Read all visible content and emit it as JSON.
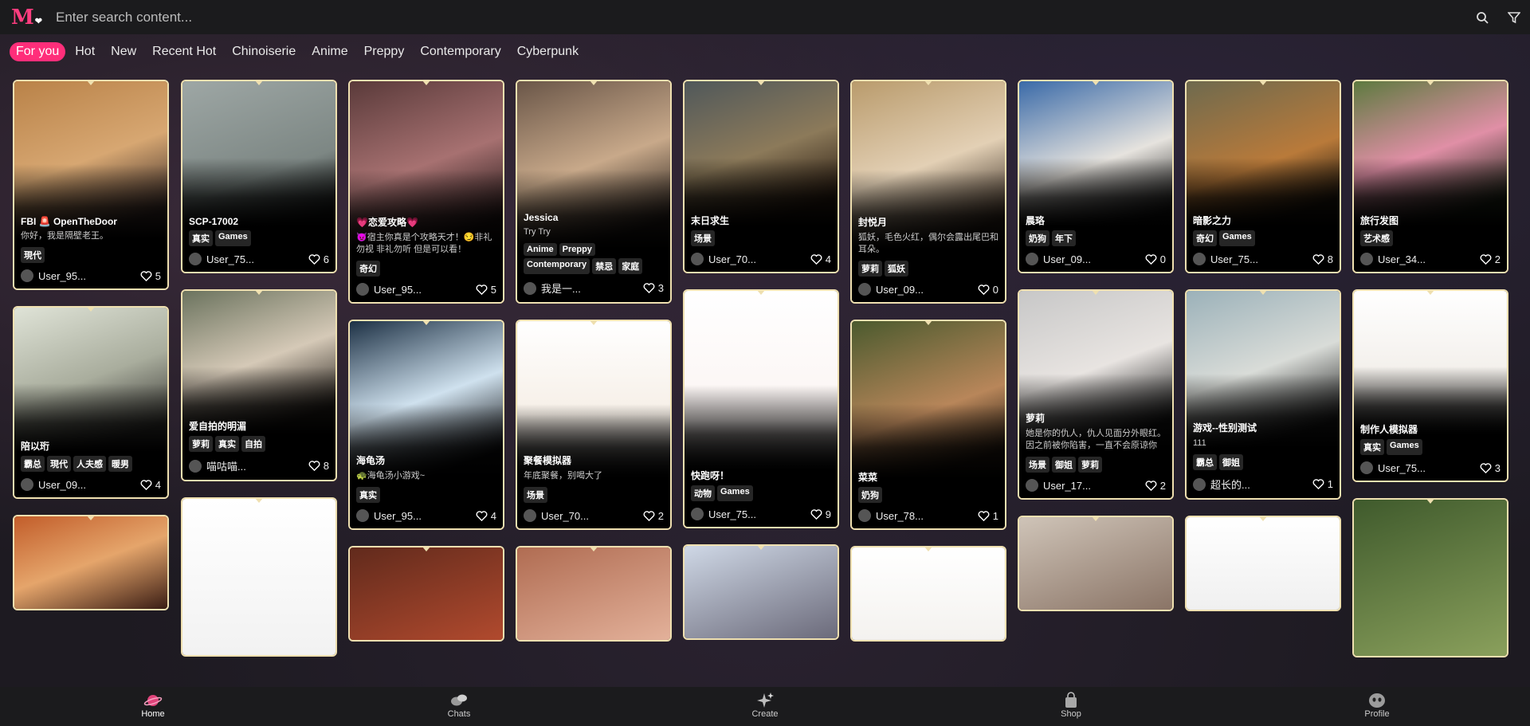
{
  "search": {
    "placeholder": "Enter search content..."
  },
  "tabs": [
    "For you",
    "Hot",
    "New",
    "Recent Hot",
    "Chinoiserie",
    "Anime",
    "Preppy",
    "Contemporary",
    "Cyberpunk"
  ],
  "active_tab": "For you",
  "columns": [
    [
      {
        "title": "FBI 🚨 OpenTheDoor",
        "desc": "你好，我是隔壁老王。",
        "tags": [
          "現代"
        ],
        "user": "User_95...",
        "likes": "5",
        "bg": "linear-gradient(160deg,#b98248,#d7a772 40%,#3a2b28 70%)"
      },
      {
        "title": "陪以珩",
        "desc": "",
        "tags": [
          "霸总",
          "現代",
          "人夫感",
          "暖男"
        ],
        "user": "User_09...",
        "likes": "4",
        "bg": "linear-gradient(160deg,#dfe3d7,#a9ad9d 40%,#3b3a36 70%)"
      },
      {
        "title": "",
        "desc": "",
        "tags": [],
        "user": "",
        "likes": "",
        "bg": "linear-gradient(160deg,#c25d2a,#e5a56b 50%,#3a1d14)"
      }
    ],
    [
      {
        "title": "SCP-17002",
        "desc": "",
        "tags": [
          "真实",
          "Games"
        ],
        "user": "User_75...",
        "likes": "6",
        "bg": "linear-gradient(160deg,#9ea7a5,#7d8784 50%,#1f2221 75%)"
      },
      {
        "title": "爱自拍的明湄",
        "desc": "",
        "tags": [
          "萝莉",
          "真实",
          "自拍"
        ],
        "user": "喵咕喵...",
        "likes": "8",
        "bg": "linear-gradient(160deg,#6b735e,#d5c9b7 40%,#2a241f 70%)"
      },
      {
        "title": "",
        "desc": "",
        "tags": [],
        "user": "",
        "likes": "",
        "bg": "linear-gradient(180deg,#ffffff,#f2f2f2)"
      }
    ],
    [
      {
        "title": "💗恋爱攻略💗",
        "desc": "😈宿主你真是个攻略天才！😏非礼勿视 非礼勿听 但是可以看！",
        "tags": [
          "奇幻"
        ],
        "user": "User_95...",
        "likes": "5",
        "bg": "linear-gradient(160deg,#5a3a3a,#a77171 40%,#1c1212 70%)"
      },
      {
        "title": "海龟汤",
        "desc": "🐢海龟汤小游戏~",
        "tags": [
          "真实"
        ],
        "user": "User_95...",
        "likes": "4",
        "bg": "linear-gradient(160deg,#1d3145,#cfe1ee 40%,#0c0c0e 70%)"
      },
      {
        "title": "",
        "desc": "",
        "tags": [],
        "user": "",
        "likes": "",
        "bg": "linear-gradient(160deg,#612a1c,#b14a2e)"
      }
    ],
    [
      {
        "title": "Jessica",
        "desc": "Try Try",
        "tags": [
          "Anime",
          "Preppy",
          "Contemporary",
          "禁忌",
          "家庭"
        ],
        "user": "我是一...",
        "likes": "3",
        "bg": "linear-gradient(160deg,#6a5648,#c8a98a 40%,#221b17 70%)"
      },
      {
        "title": "聚餐模拟器",
        "desc": "年底聚餐，别喝大了",
        "tags": [
          "场景"
        ],
        "user": "User_70...",
        "likes": "2",
        "bg": "linear-gradient(180deg,#ffffff 0%,#f6efe7 45%,#222 75%)"
      },
      {
        "title": "",
        "desc": "",
        "tags": [],
        "user": "",
        "likes": "",
        "bg": "linear-gradient(160deg,#b06c52,#e3b19a)"
      }
    ],
    [
      {
        "title": "末日求生",
        "desc": "",
        "tags": [
          "场景"
        ],
        "user": "User_70...",
        "likes": "4",
        "bg": "linear-gradient(160deg,#50585a,#8c7a5a 40%,#2a1b10 70%)"
      },
      {
        "title": "快跑呀！",
        "desc": "",
        "tags": [
          "动物",
          "Games"
        ],
        "user": "User_75...",
        "likes": "9",
        "bg": "linear-gradient(180deg,#ffffff 0%,#fbf4f2 55%,#222 80%)"
      },
      {
        "title": "",
        "desc": "",
        "tags": [],
        "user": "",
        "likes": "",
        "bg": "linear-gradient(160deg,#cfd8e6,#6b6a7a)"
      }
    ],
    [
      {
        "title": "封悦月",
        "desc": "狐妖，毛色火红，偶尔会露出尾巴和耳朵。",
        "tags": [
          "萝莉",
          "狐妖"
        ],
        "user": "User_09...",
        "likes": "0",
        "bg": "linear-gradient(160deg,#b99b6c,#e3d0b5 40%,#2d2118 70%)"
      },
      {
        "title": "菜菜",
        "desc": "",
        "tags": [
          "奶狗"
        ],
        "user": "User_78...",
        "likes": "1",
        "bg": "linear-gradient(160deg,#4b5a2e,#b8865a 45%,#251a10 70%)"
      },
      {
        "title": "",
        "desc": "",
        "tags": [],
        "user": "",
        "likes": "",
        "bg": "linear-gradient(180deg,#ffffff,#f4f2ef)"
      }
    ],
    [
      {
        "title": "晨珞",
        "desc": "",
        "tags": [
          "奶狗",
          "年下"
        ],
        "user": "User_09...",
        "likes": "0",
        "bg": "linear-gradient(160deg,#3a6aa8,#e6e3de 45%,#1c1c1c 75%)"
      },
      {
        "title": "萝莉",
        "desc": "她是你的仇人，仇人见面分外眼红。因之前被你陷害，一直不会原谅你",
        "tags": [
          "场景",
          "御姐",
          "萝莉"
        ],
        "user": "User_17...",
        "likes": "2",
        "bg": "linear-gradient(160deg,#c7c7c7,#e8e4e1 40%,#161616 70%)"
      },
      {
        "title": "",
        "desc": "",
        "tags": [],
        "user": "",
        "likes": "",
        "bg": "linear-gradient(160deg,#cfc4b8,#8a7466)"
      }
    ],
    [
      {
        "title": "暗影之力",
        "desc": "",
        "tags": [
          "奇幻",
          "Games"
        ],
        "user": "User_75...",
        "likes": "8",
        "bg": "linear-gradient(160deg,#6e6a4e,#b97a3a 45%,#20180e 70%)"
      },
      {
        "title": "游戏--性别测试",
        "desc": "111",
        "tags": [
          "霸总",
          "御姐"
        ],
        "user": "超长的...",
        "likes": "1",
        "bg": "linear-gradient(160deg,#9bb1b9,#d9dcd8 40%,#1a1a1a 70%)"
      },
      {
        "title": "",
        "desc": "",
        "tags": [],
        "user": "",
        "likes": "",
        "bg": "linear-gradient(180deg,#ffffff,#f0f0f0)"
      }
    ],
    [
      {
        "title": "旅行发图",
        "desc": "",
        "tags": [
          "艺术感"
        ],
        "user": "User_34...",
        "likes": "2",
        "bg": "linear-gradient(160deg,#5d7a3f,#e08fa6 40%,#1c2416 70%)"
      },
      {
        "title": "制作人模拟器",
        "desc": "",
        "tags": [
          "真实",
          "Games"
        ],
        "user": "User_75...",
        "likes": "3",
        "bg": "linear-gradient(180deg,#ffffff 0%,#f1ede8 50%,#222 78%)"
      },
      {
        "title": "",
        "desc": "",
        "tags": [],
        "user": "",
        "likes": "",
        "bg": "linear-gradient(160deg,#3f5a2c,#8aa05c)"
      }
    ]
  ],
  "bottom_nav": [
    "Home",
    "Chats",
    "Create",
    "Shop",
    "Profile"
  ],
  "active_nav": "Home"
}
